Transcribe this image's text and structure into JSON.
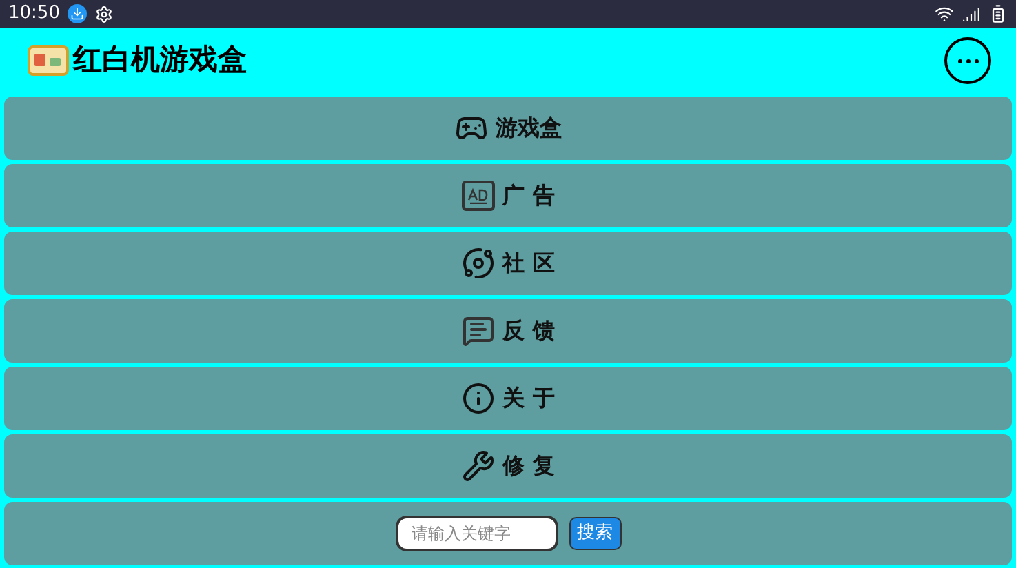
{
  "status_bar": {
    "time": "10:50"
  },
  "app_bar": {
    "title": "红白机游戏盒"
  },
  "menu": [
    {
      "kind": "gamepad",
      "label": "游戏盒"
    },
    {
      "kind": "ad",
      "label": "广 告"
    },
    {
      "kind": "planet",
      "label": "社 区"
    },
    {
      "kind": "chat",
      "label": "反 馈"
    },
    {
      "kind": "info",
      "label": "关 于"
    },
    {
      "kind": "tools",
      "label": "修 复"
    }
  ],
  "search": {
    "placeholder": "请输入关键字",
    "button": "搜索"
  }
}
